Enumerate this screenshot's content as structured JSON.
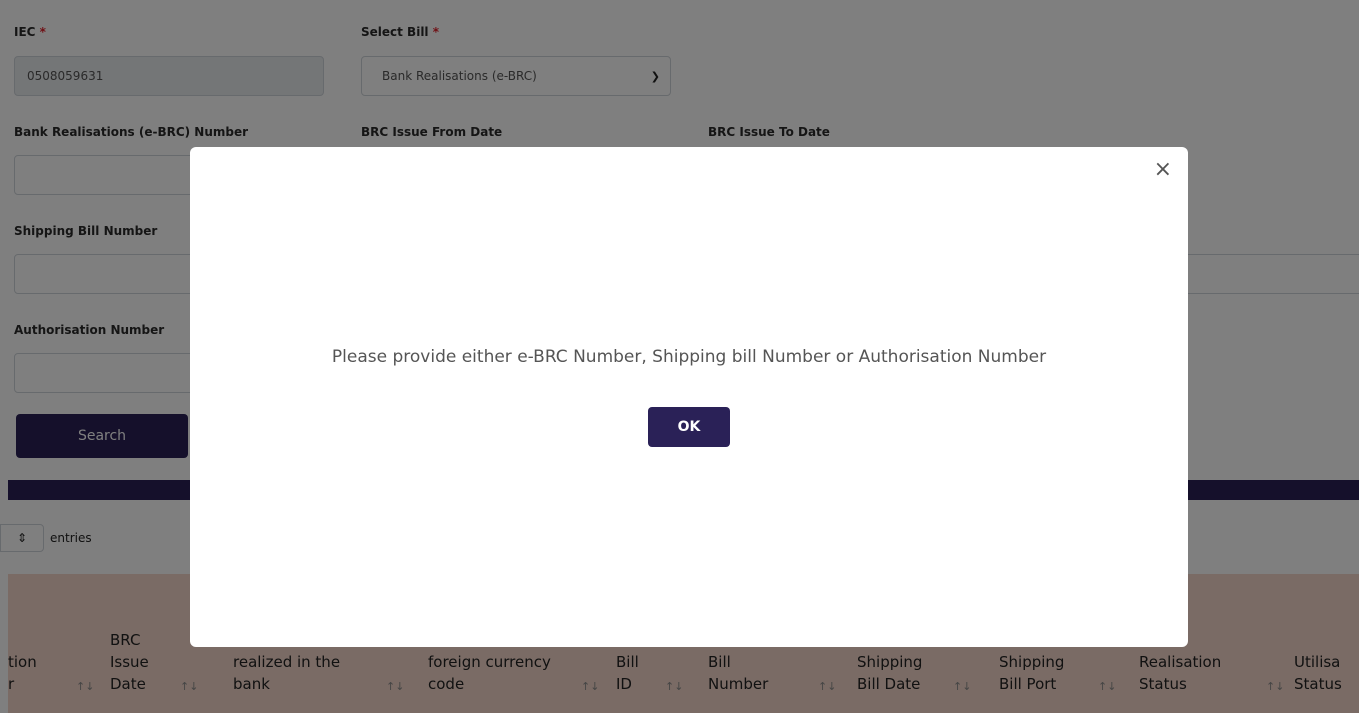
{
  "form": {
    "iec": {
      "label": "IEC",
      "required_mark": "*",
      "value": "0508059631"
    },
    "select_bill": {
      "label": "Select Bill",
      "required_mark": "*",
      "value": "Bank Realisations (e-BRC)"
    },
    "ebrc_number": {
      "label": "Bank Realisations (e-BRC) Number",
      "value": ""
    },
    "brc_from": {
      "label": "BRC Issue From Date"
    },
    "brc_to": {
      "label": "BRC Issue To Date"
    },
    "shipping_bill": {
      "label": "Shipping Bill Number",
      "value": ""
    },
    "authorisation": {
      "label": "Authorisation Number",
      "value": ""
    },
    "search_label": "Search"
  },
  "table": {
    "entries_label": "entries",
    "headers": [
      "tion\nr",
      "BRC\nIssue\nDate",
      "realized in the\nbank",
      "foreign currency\ncode",
      "Bill\nID",
      "Bill\nNumber",
      "Shipping\nBill Date",
      "Shipping\nBill Port",
      "Realisation\nStatus",
      "Utilisa\nStatus"
    ],
    "sort_icon": "sort-arrows-icon"
  },
  "modal": {
    "message": "Please provide either e-BRC Number, Shipping bill Number or Authorisation Number",
    "ok_label": "OK",
    "close_glyph": "×"
  },
  "colors": {
    "primary": "#2a2157",
    "required": "#e0202a",
    "table_header": "#f4d7cb",
    "overlay": "rgba(0,0,0,0.5)"
  }
}
